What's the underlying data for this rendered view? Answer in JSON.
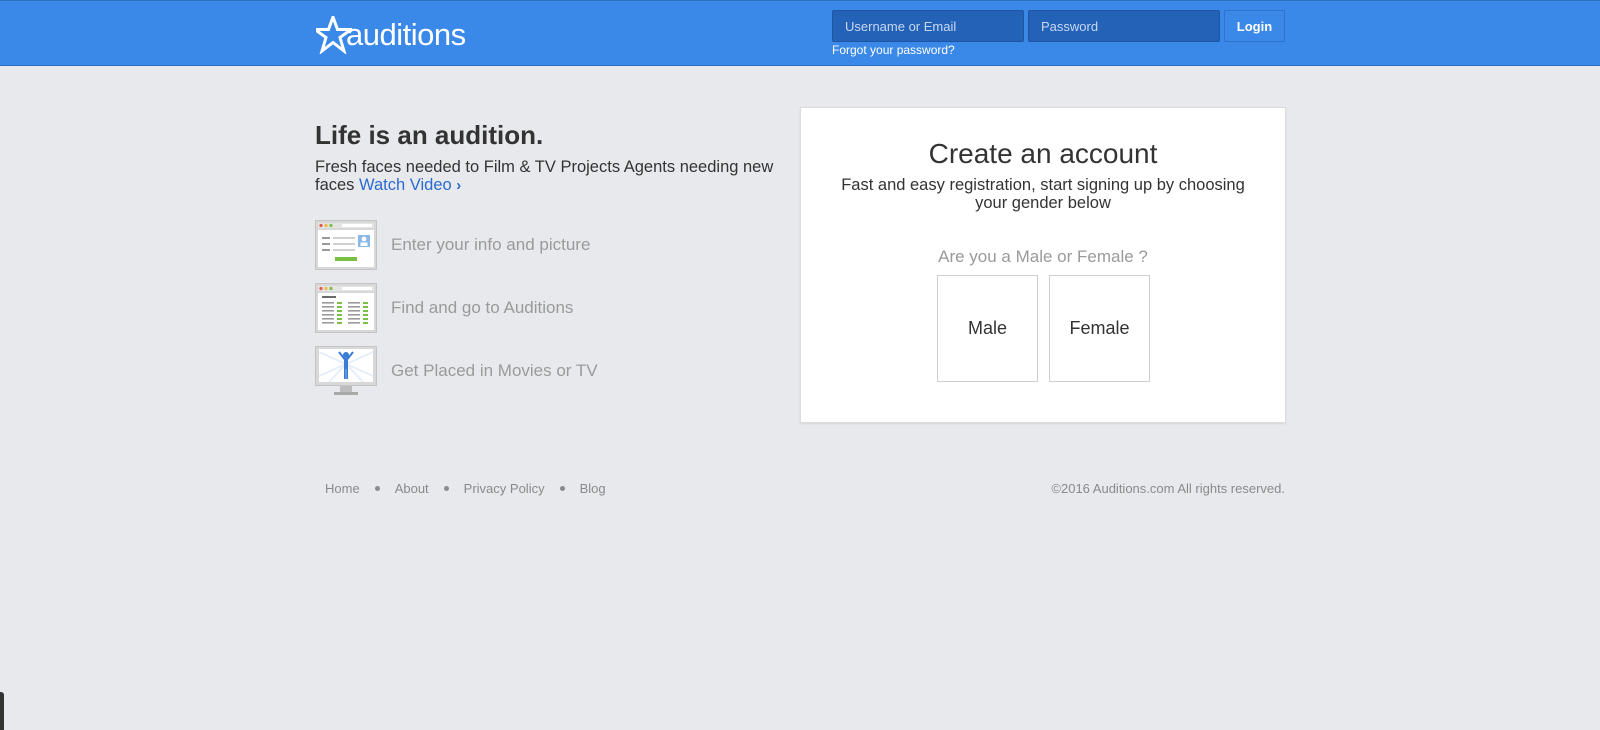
{
  "header": {
    "logo_text": "auditions",
    "username_placeholder": "Username or Email",
    "password_placeholder": "Password",
    "login_label": "Login",
    "forgot_label": "Forgot your password?",
    "colors": {
      "bar": "#3a89e8",
      "input": "#2462b8"
    }
  },
  "hero": {
    "headline": "Life is an audition.",
    "tagline": "Fresh faces needed to Film & TV Projects Agents needing new faces",
    "video_link": "Watch Video",
    "video_chevron": "›",
    "steps": [
      {
        "icon": "profile-form-icon",
        "label": "Enter your info and picture"
      },
      {
        "icon": "auditions-list-icon",
        "label": "Find and go to Auditions"
      },
      {
        "icon": "screen-performer-icon",
        "label": "Get Placed in Movies or TV"
      }
    ]
  },
  "signup": {
    "title": "Create an account",
    "subtitle": "Fast and easy registration, start signing up by choosing your gender below",
    "question": "Are you a Male or Female ?",
    "male_label": "Male",
    "female_label": "Female"
  },
  "footer": {
    "links": [
      "Home",
      "About",
      "Privacy Policy",
      "Blog"
    ],
    "copyright": "©2016 Auditions.com All rights reserved."
  }
}
